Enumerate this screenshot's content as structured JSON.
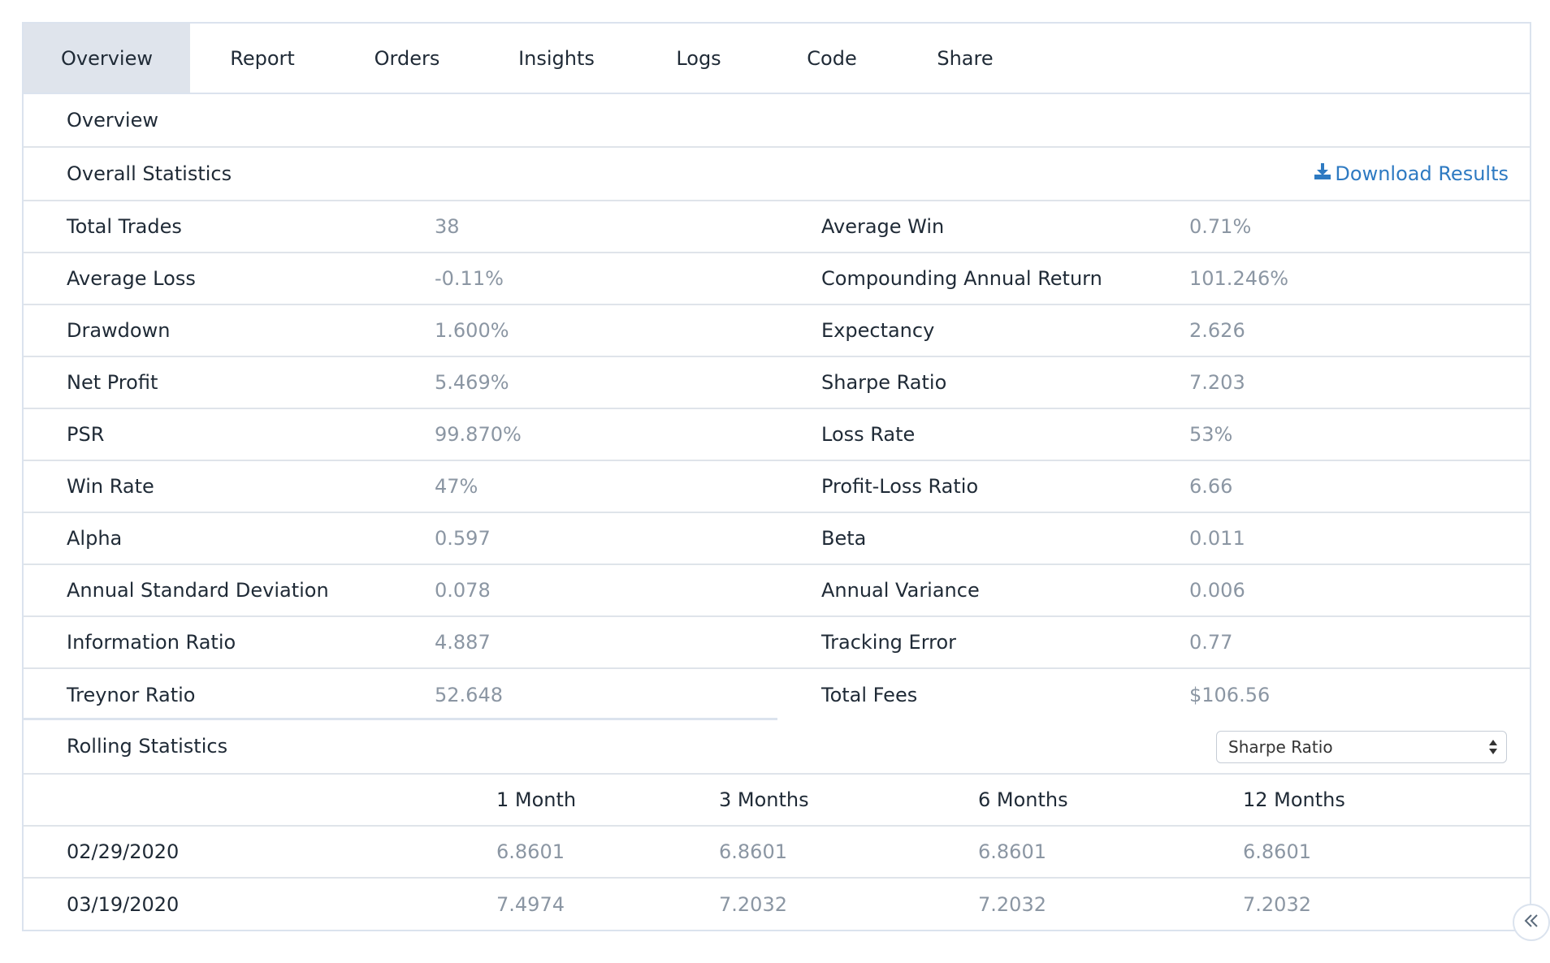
{
  "tabs": [
    {
      "label": "Overview",
      "active": true
    },
    {
      "label": "Report"
    },
    {
      "label": "Orders"
    },
    {
      "label": "Insights"
    },
    {
      "label": "Logs"
    },
    {
      "label": "Code"
    },
    {
      "label": "Share"
    }
  ],
  "overview_heading": "Overview",
  "overall": {
    "title": "Overall Statistics",
    "download_label": "Download Results",
    "download_icon": "download-icon",
    "rows": [
      {
        "l_label": "Total Trades",
        "l_value": "38",
        "r_label": "Average Win",
        "r_value": "0.71%"
      },
      {
        "l_label": "Average Loss",
        "l_value": "-0.11%",
        "r_label": "Compounding Annual Return",
        "r_value": "101.246%"
      },
      {
        "l_label": "Drawdown",
        "l_value": "1.600%",
        "r_label": "Expectancy",
        "r_value": "2.626"
      },
      {
        "l_label": "Net Profit",
        "l_value": "5.469%",
        "r_label": "Sharpe Ratio",
        "r_value": "7.203"
      },
      {
        "l_label": "PSR",
        "l_value": "99.870%",
        "r_label": "Loss Rate",
        "r_value": "53%"
      },
      {
        "l_label": "Win Rate",
        "l_value": "47%",
        "r_label": "Profit-Loss Ratio",
        "r_value": "6.66"
      },
      {
        "l_label": "Alpha",
        "l_value": "0.597",
        "r_label": "Beta",
        "r_value": "0.011"
      },
      {
        "l_label": "Annual Standard Deviation",
        "l_value": "0.078",
        "r_label": "Annual Variance",
        "r_value": "0.006"
      },
      {
        "l_label": "Information Ratio",
        "l_value": "4.887",
        "r_label": "Tracking Error",
        "r_value": "0.77"
      },
      {
        "l_label": "Treynor Ratio",
        "l_value": "52.648",
        "r_label": "Total Fees",
        "r_value": "$106.56"
      }
    ]
  },
  "rolling": {
    "title": "Rolling Statistics",
    "select_value": "Sharpe Ratio",
    "columns": [
      "1 Month",
      "3 Months",
      "6 Months",
      "12 Months"
    ],
    "rows": [
      {
        "date": "02/29/2020",
        "values": [
          "6.8601",
          "6.8601",
          "6.8601",
          "6.8601"
        ]
      },
      {
        "date": "03/19/2020",
        "values": [
          "7.4974",
          "7.2032",
          "7.2032",
          "7.2032"
        ]
      }
    ]
  },
  "colors": {
    "accent": "#2e7ac2",
    "active_tab_bg": "#dfe4ec",
    "value_text": "#8b96a3",
    "border": "#dbe3ee"
  },
  "collapse_icon": "double-chevron-left-icon"
}
